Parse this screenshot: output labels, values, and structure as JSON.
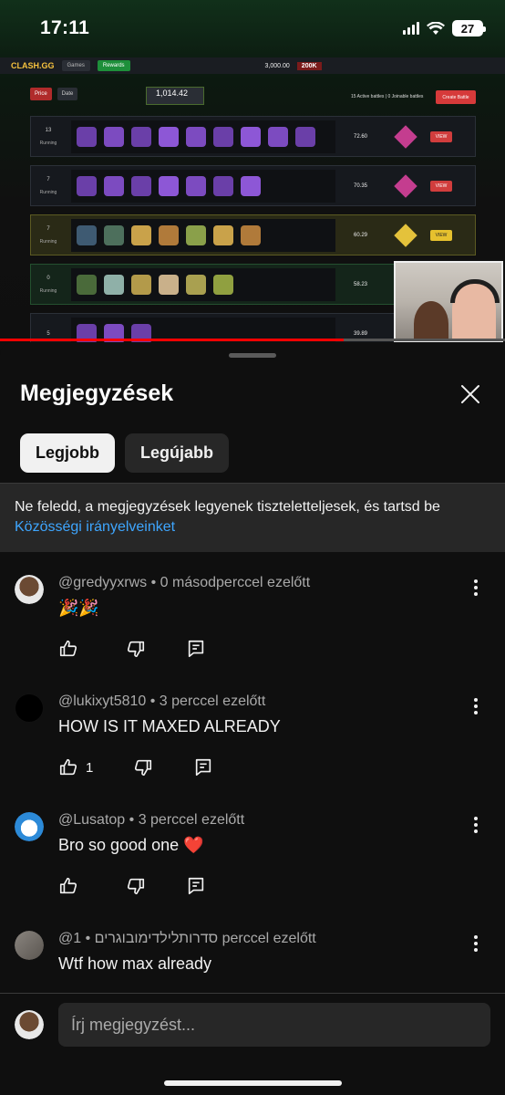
{
  "status_bar": {
    "time": "17:11",
    "battery": "27"
  },
  "video": {
    "progress": 0.68,
    "site": {
      "brand": "CLASH.GG",
      "nav": [
        "Games",
        "Rewards"
      ],
      "balance": "3,000.00",
      "banner": "200K",
      "filters": [
        "Price",
        "Date"
      ],
      "battle_total": "1,014.42",
      "active_info": "15 Active battles  |  0 Joinable battles",
      "create_label": "Create Battle",
      "rows": [
        {
          "count": "13",
          "status": "Running",
          "value": "72.60",
          "view": "VIEW",
          "kind": "normal"
        },
        {
          "count": "7",
          "status": "Running",
          "value": "70.35",
          "view": "VIEW",
          "kind": "normal"
        },
        {
          "count": "7",
          "status": "Running",
          "value": "60.29",
          "view": "VIEW",
          "kind": "gold"
        },
        {
          "count": "0",
          "status": "Running",
          "value": "58.23",
          "view": "",
          "kind": "green"
        },
        {
          "count": "5",
          "status": "",
          "value": "39.89",
          "view": "",
          "kind": "normal"
        }
      ]
    }
  },
  "sheet": {
    "title": "Megjegyzések",
    "chips": [
      {
        "label": "Legjobb",
        "selected": true
      },
      {
        "label": "Legújabb",
        "selected": false
      }
    ],
    "notice": {
      "text": "Ne feledd, a megjegyzések legyenek tiszteletteljesek, és tartsd be",
      "link": "Közösségi irányelveinket"
    }
  },
  "comments": [
    {
      "author": "@gredyyxrws",
      "time": "0 másodperccel ezelőtt",
      "text": "🎉🎉",
      "likes": "",
      "avatar": "face"
    },
    {
      "author": "@lukixyt5810",
      "time": "3 perccel ezelőtt",
      "text": "HOW IS IT MAXED ALREADY",
      "likes": "1",
      "avatar": "black"
    },
    {
      "author": "@Lusatop",
      "time": "3 perccel ezelőtt",
      "text": "Bro so good one ❤️",
      "likes": "",
      "avatar": "doraemon"
    },
    {
      "author": "@סדרותלילדימובוגרים",
      "time": "1 perccel ezelőtt",
      "text": "Wtf how max already",
      "likes": "",
      "avatar": "wall"
    }
  ],
  "composer": {
    "placeholder": "Írj megjegyzést..."
  },
  "icons": {
    "like": "thumbs-up-icon",
    "dislike": "thumbs-down-icon",
    "reply": "reply-icon",
    "more": "more-vertical-icon",
    "close": "close-icon"
  },
  "colors": {
    "accent_link": "#3ea6ff",
    "progress": "#ff0000",
    "chip_bg": "#272727"
  }
}
